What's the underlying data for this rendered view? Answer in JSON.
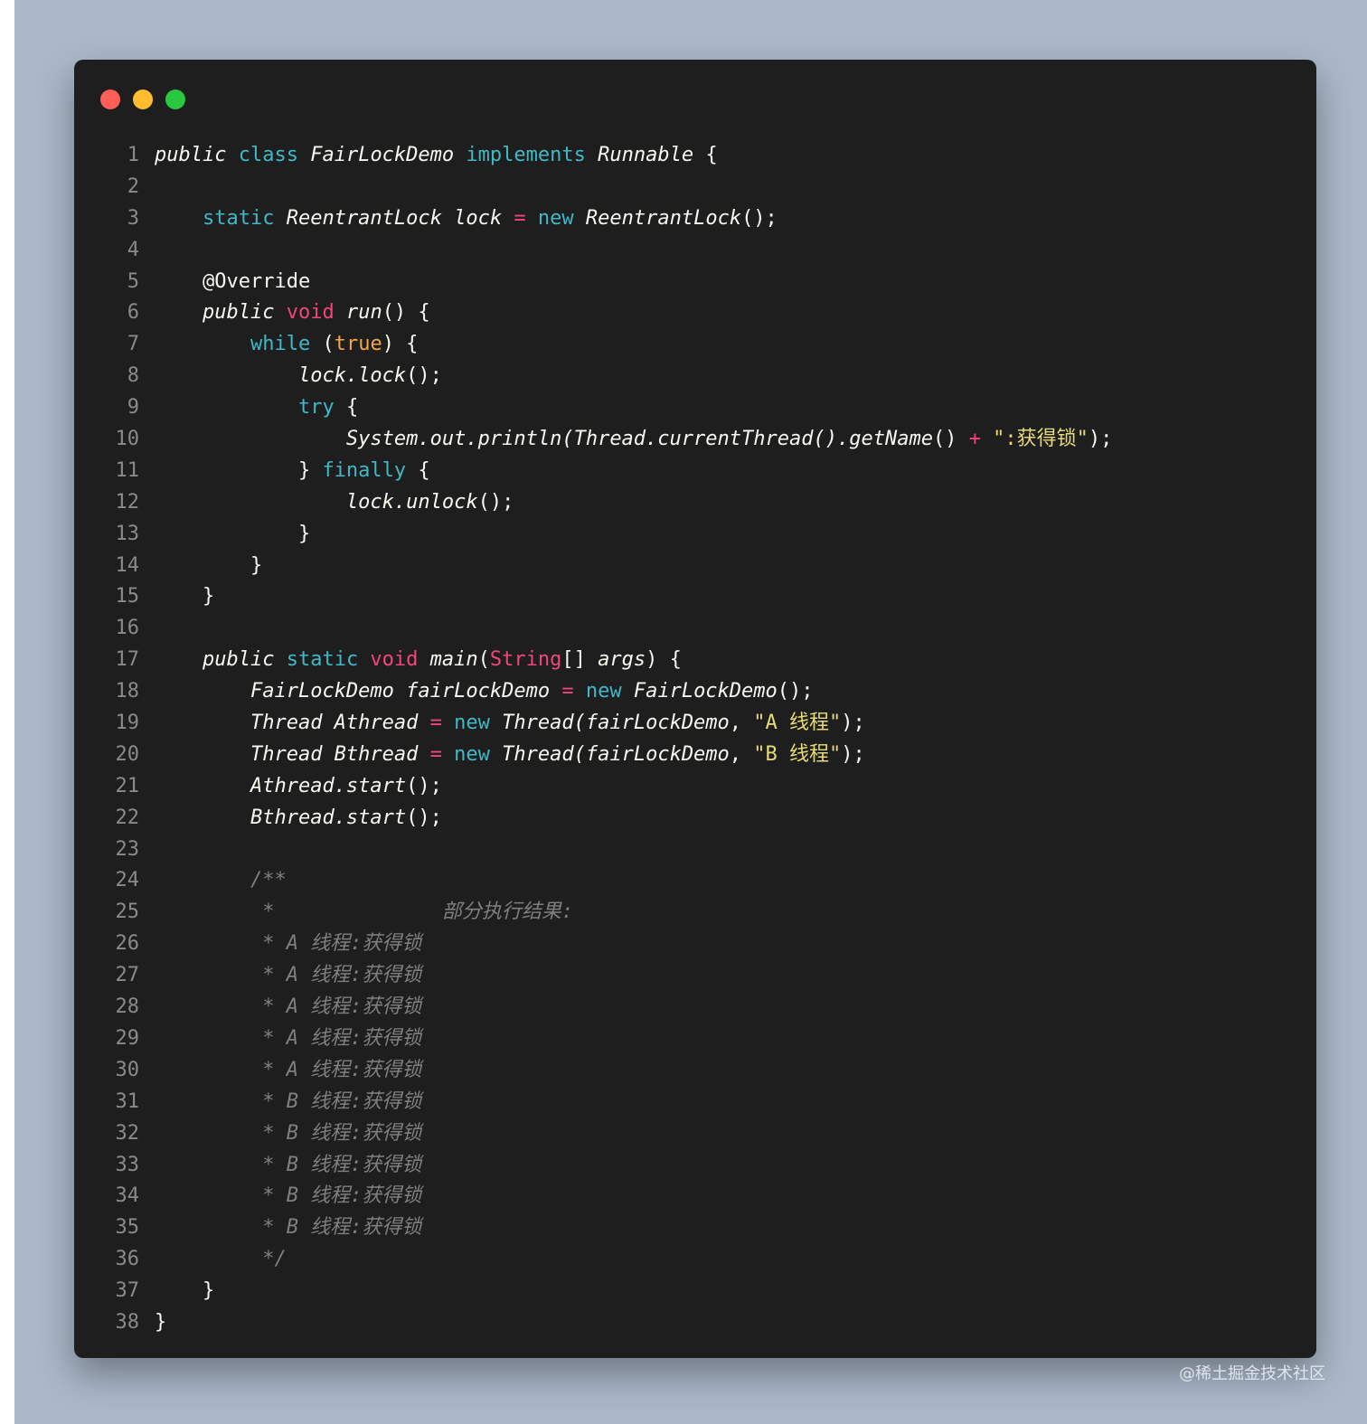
{
  "window": {
    "controls": [
      {
        "name": "close",
        "color": "#ff5f57"
      },
      {
        "name": "minimize",
        "color": "#febc2e"
      },
      {
        "name": "zoom",
        "color": "#28c840"
      }
    ]
  },
  "code": {
    "lines": [
      [
        [
          "k-pub",
          "public"
        ],
        [
          "",
          ""
        ],
        [
          "k-cyan",
          " class"
        ],
        [
          "it",
          " FairLockDemo"
        ],
        [
          "k-cyan",
          " implements"
        ],
        [
          "it",
          " Runnable"
        ],
        [
          "",
          " {"
        ]
      ],
      [],
      [
        [
          "",
          "    "
        ],
        [
          "k-cyan",
          "static"
        ],
        [
          "it",
          " ReentrantLock lock"
        ],
        [
          "op",
          " ="
        ],
        [
          "k-cyan",
          " new"
        ],
        [
          "it",
          " ReentrantLock"
        ],
        [
          "",
          "();"
        ]
      ],
      [],
      [
        [
          "",
          "    @Override"
        ]
      ],
      [
        [
          "",
          "    "
        ],
        [
          "k-pub",
          "public"
        ],
        [
          "k-pink",
          " void"
        ],
        [
          "it",
          " run"
        ],
        [
          "",
          "() {"
        ]
      ],
      [
        [
          "",
          "        "
        ],
        [
          "k-cyan",
          "while"
        ],
        [
          "",
          " ("
        ],
        [
          "k-orange",
          "true"
        ],
        [
          "",
          ") {"
        ]
      ],
      [
        [
          "",
          "            "
        ],
        [
          "it",
          "lock.lock"
        ],
        [
          "",
          "();"
        ]
      ],
      [
        [
          "",
          "            "
        ],
        [
          "k-cyan",
          "try"
        ],
        [
          "",
          " {"
        ]
      ],
      [
        [
          "",
          "                "
        ],
        [
          "it",
          "System.out.println(Thread.currentThread().getName"
        ],
        [
          "",
          "() "
        ],
        [
          "op",
          "+"
        ],
        [
          "str",
          " \":获得锁\""
        ],
        [
          "",
          ");"
        ]
      ],
      [
        [
          "",
          "            } "
        ],
        [
          "k-cyan",
          "finally"
        ],
        [
          "",
          " {"
        ]
      ],
      [
        [
          "",
          "                "
        ],
        [
          "it",
          "lock.unlock"
        ],
        [
          "",
          "();"
        ]
      ],
      [
        [
          "",
          "            }"
        ]
      ],
      [
        [
          "",
          "        }"
        ]
      ],
      [
        [
          "",
          "    }"
        ]
      ],
      [],
      [
        [
          "",
          "    "
        ],
        [
          "k-pub",
          "public"
        ],
        [
          "k-cyan",
          " static"
        ],
        [
          "k-pink",
          " void"
        ],
        [
          "it",
          " main"
        ],
        [
          "",
          "("
        ],
        [
          "k-pink",
          "String"
        ],
        [
          "",
          "[] "
        ],
        [
          "it",
          "args"
        ],
        [
          "",
          ") {"
        ]
      ],
      [
        [
          "",
          "        "
        ],
        [
          "it",
          "FairLockDemo fairLockDemo"
        ],
        [
          "op",
          " ="
        ],
        [
          "k-cyan",
          " new"
        ],
        [
          "it",
          " FairLockDemo"
        ],
        [
          "",
          "();"
        ]
      ],
      [
        [
          "",
          "        "
        ],
        [
          "it",
          "Thread Athread"
        ],
        [
          "op",
          " ="
        ],
        [
          "k-cyan",
          " new"
        ],
        [
          "it",
          " Thread(fairLockDemo"
        ],
        [
          "",
          ", "
        ],
        [
          "str",
          "\"A 线程\""
        ],
        [
          "",
          ");"
        ]
      ],
      [
        [
          "",
          "        "
        ],
        [
          "it",
          "Thread Bthread"
        ],
        [
          "op",
          " ="
        ],
        [
          "k-cyan",
          " new"
        ],
        [
          "it",
          " Thread(fairLockDemo"
        ],
        [
          "",
          ", "
        ],
        [
          "str",
          "\"B 线程\""
        ],
        [
          "",
          ");"
        ]
      ],
      [
        [
          "",
          "        "
        ],
        [
          "it",
          "Athread.start"
        ],
        [
          "",
          "();"
        ]
      ],
      [
        [
          "",
          "        "
        ],
        [
          "it",
          "Bthread.start"
        ],
        [
          "",
          "();"
        ]
      ],
      [],
      [
        [
          "cm",
          "        /**"
        ]
      ],
      [
        [
          "cm",
          "         *              部分执行结果:"
        ]
      ],
      [
        [
          "cm",
          "         * A 线程:获得锁"
        ]
      ],
      [
        [
          "cm",
          "         * A 线程:获得锁"
        ]
      ],
      [
        [
          "cm",
          "         * A 线程:获得锁"
        ]
      ],
      [
        [
          "cm",
          "         * A 线程:获得锁"
        ]
      ],
      [
        [
          "cm",
          "         * A 线程:获得锁"
        ]
      ],
      [
        [
          "cm",
          "         * B 线程:获得锁"
        ]
      ],
      [
        [
          "cm",
          "         * B 线程:获得锁"
        ]
      ],
      [
        [
          "cm",
          "         * B 线程:获得锁"
        ]
      ],
      [
        [
          "cm",
          "         * B 线程:获得锁"
        ]
      ],
      [
        [
          "cm",
          "         * B 线程:获得锁"
        ]
      ],
      [
        [
          "cm",
          "         */"
        ]
      ],
      [
        [
          "",
          "    }"
        ]
      ],
      [
        [
          "",
          "}"
        ]
      ]
    ]
  },
  "watermark": "@稀土掘金技术社区"
}
